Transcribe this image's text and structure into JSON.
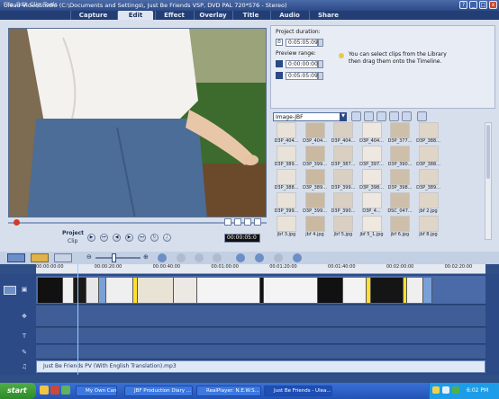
{
  "window": {
    "title": "Ulead VideoStudio (C:\\Documents and Settings\\, Just Be Friends VSP, DVD PAL 720*576 - Stereo)"
  },
  "menu": [
    "File",
    "Edit",
    "Clip",
    "Tools"
  ],
  "steps": [
    {
      "label": "Capture",
      "active": false
    },
    {
      "label": "Edit",
      "active": true
    },
    {
      "label": "Effect",
      "active": false
    },
    {
      "label": "Overlay",
      "active": false
    },
    {
      "label": "Title",
      "active": false
    },
    {
      "label": "Audio",
      "active": false
    },
    {
      "label": "Share",
      "active": false
    }
  ],
  "options": {
    "project_duration_label": "Project duration:",
    "project_duration_value": "0:05:05:09",
    "preview_range_label": "Preview range:",
    "preview_start": "0:00:00:00",
    "preview_end": "0:05:05:09",
    "hint": "You can select clips from the Library then drag them onto the Timeline."
  },
  "library": {
    "dropdown": "Image-JBF",
    "thumbs": [
      "D3P_404...",
      "D3P_404...",
      "D3P_404...",
      "D3P_404...",
      "D3P_377...",
      "D3P_388...",
      "D3P_389...",
      "D3P_399...",
      "D3P_387...",
      "D3P_397...",
      "D3P_390...",
      "D3P_388...",
      "D3P_388...",
      "D3P_389...",
      "D3P_399...",
      "D3P_398...",
      "D3P_398...",
      "D3P_389...",
      "D3P_399...",
      "D3P_399...",
      "D3P_390...",
      "D3P_4...",
      "DSC_047...",
      "jbf 2.jpg",
      "jbf 3.jpg",
      "jbf 4.jpg",
      "jbf 5.jpg",
      "jbf 5_1.jpg",
      "jbf 6.jpg",
      "jbf 8.jpg"
    ]
  },
  "nav": {
    "project_label": "Project",
    "clip_label": "Clip",
    "timecode": "00:00:05:0"
  },
  "timeline": {
    "ticks": [
      "00:00:00:00",
      "00:00:20:00",
      "00:00:40:00",
      "00:01:00:00",
      "00:01:20:00",
      "00:01:40:00",
      "00:02:00:00",
      "00:02:20:00"
    ],
    "audio_clip": "Just Be Friends     PV (With English Translation).mp3"
  },
  "taskbar": {
    "start": "start",
    "tasks": [
      {
        "label": "My Own Cam",
        "active": false
      },
      {
        "label": "JBF Production Diary ...",
        "active": false
      },
      {
        "label": "RealPlayer: N.E.W.S...",
        "active": false
      },
      {
        "label": "Just Be Friends - Ulea...",
        "active": true
      }
    ],
    "clock": "6:02 PM"
  },
  "colors": {
    "accent": "#2b4a86",
    "panel": "#d7dfec",
    "track": "#3f5e98"
  }
}
